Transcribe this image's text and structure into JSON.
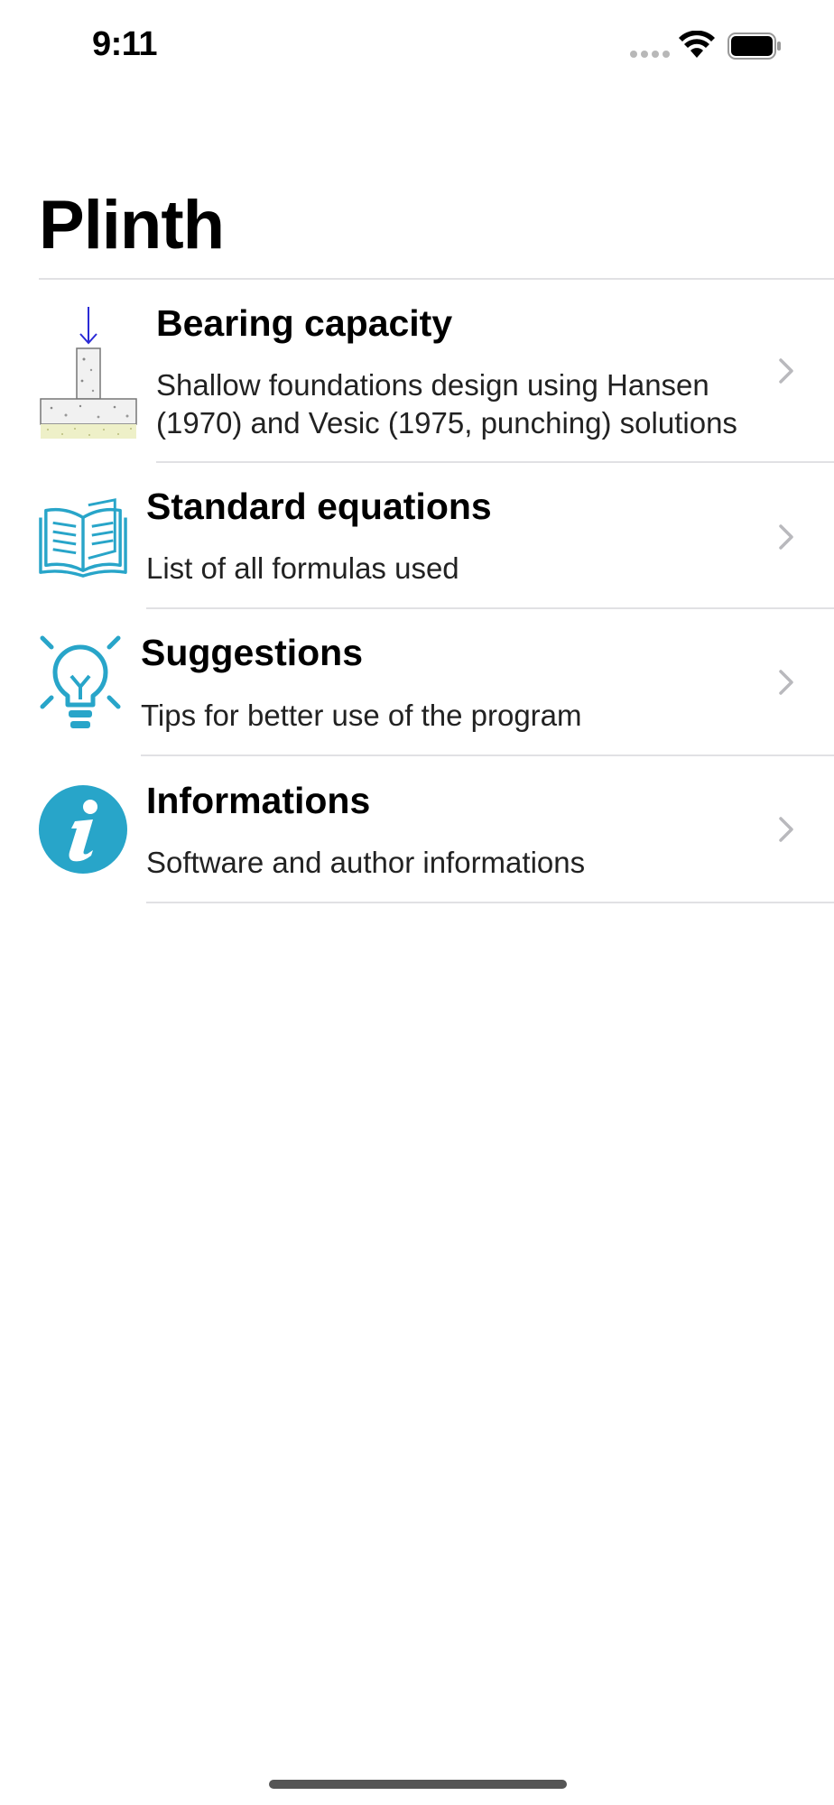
{
  "status_bar": {
    "time": "9:11"
  },
  "nav": {
    "title": "Plinth"
  },
  "menu": {
    "items": [
      {
        "title": "Bearing capacity",
        "subtitle_line1": "Shallow foundations design using Hansen",
        "subtitle_line2": "(1970) and Vesic (1975, punching) solutions",
        "icon": "foundation-icon"
      },
      {
        "title": "Standard equations",
        "subtitle_line1": "List of all formulas used",
        "icon": "book-icon"
      },
      {
        "title": "Suggestions",
        "subtitle_line1": "Tips for better use of the program",
        "icon": "lightbulb-icon"
      },
      {
        "title": "Informations",
        "subtitle_line1": "Software and author informations",
        "icon": "info-icon"
      }
    ]
  },
  "colors": {
    "accent": "#28a5c9",
    "arrow": "#2b2bd6",
    "separator": "#e1e1e4",
    "chevron": "#b9b9bd"
  }
}
